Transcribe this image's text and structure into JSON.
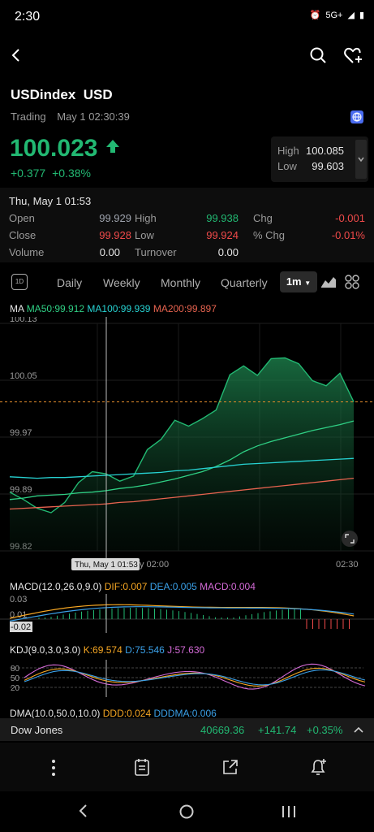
{
  "status": {
    "time": "2:30",
    "network": "5G+"
  },
  "header": {
    "title": "USDindex  USD",
    "trading_status": "Trading",
    "timestamp": "May 1 02:30:39",
    "price": "100.023",
    "change": "+0.377",
    "change_pct": "+0.38%",
    "high_label": "High",
    "high": "100.085",
    "low_label": "Low",
    "low": "99.603"
  },
  "details": {
    "date": "Thu, May 1 01:53",
    "open_label": "Open",
    "open": "99.929",
    "close_label": "Close",
    "close": "99.928",
    "volume_label": "Volume",
    "volume": "0.00",
    "high_label": "High",
    "high": "99.938",
    "low_label": "Low",
    "low": "99.924",
    "turnover_label": "Turnover",
    "turnover": "0.00",
    "chg_label": "Chg",
    "chg": "-0.001",
    "pct_chg_label": "% Chg",
    "pct_chg": "-0.01%"
  },
  "tabs": {
    "intraday_icon": "1D",
    "daily": "Daily",
    "weekly": "Weekly",
    "monthly": "Monthly",
    "quarterly": "Quarterly",
    "active": "1m"
  },
  "ma": {
    "label": "MA",
    "ma50": "MA50:99.912",
    "ma100": "MA100:99.939",
    "ma200": "MA200:99.897"
  },
  "colors": {
    "up": "#22b872",
    "down": "#f04a4a",
    "ma50": "#2fcf84",
    "ma100": "#27d3d3",
    "ma200": "#e7634f",
    "dif": "#f5a623",
    "dea": "#3aa0e8",
    "k": "#f5a623",
    "d": "#3aa0e8",
    "j": "#d36ad6"
  },
  "chart_data": {
    "type": "area",
    "y_ticks": [
      "100.13",
      "100.05",
      "99.97",
      "99.89",
      "99.82"
    ],
    "ylim": [
      99.82,
      100.13
    ],
    "x_ticks": [
      "y 02:00",
      "02:30"
    ],
    "crosshair_label": "Thu, May 1 01:53",
    "series": [
      {
        "name": "MA50",
        "values": [
          99.89,
          99.892,
          99.895,
          99.896,
          99.897,
          99.899,
          99.9,
          99.902,
          99.905,
          99.907,
          99.91,
          99.914,
          99.918,
          99.923,
          99.928,
          99.935,
          99.944,
          99.955,
          99.963,
          99.969,
          99.974,
          99.979,
          99.984,
          99.988,
          99.992,
          99.997
        ]
      },
      {
        "name": "MA100",
        "values": [
          99.921,
          99.92,
          99.919,
          99.92,
          99.92,
          99.921,
          99.922,
          99.923,
          99.924,
          99.925,
          99.926,
          99.927,
          99.929,
          99.93,
          99.932,
          99.934,
          99.936,
          99.938,
          99.939,
          99.94,
          99.941,
          99.942,
          99.943,
          99.944,
          99.945,
          99.946
        ]
      },
      {
        "name": "MA200",
        "values": [
          99.877,
          99.878,
          99.879,
          99.88,
          99.881,
          99.882,
          99.883,
          99.884,
          99.886,
          99.887,
          99.889,
          99.891,
          99.893,
          99.895,
          99.897,
          99.899,
          99.901,
          99.903,
          99.905,
          99.907,
          99.909,
          99.911,
          99.913,
          99.915,
          99.917,
          99.919
        ]
      },
      {
        "name": "Price",
        "values": [
          99.9,
          99.89,
          99.878,
          99.872,
          99.886,
          99.913,
          99.928,
          99.925,
          99.915,
          99.922,
          99.958,
          99.972,
          99.998,
          99.99,
          100.0,
          100.012,
          100.06,
          100.072,
          100.059,
          100.082,
          100.083,
          100.075,
          100.052,
          100.045,
          100.062,
          100.023
        ]
      }
    ],
    "reference_line": 100.023
  },
  "macd": {
    "label": "MACD(12.0,26.0,9.0)",
    "dif": "DIF:0.007",
    "dea": "DEA:0.005",
    "macd": "MACD:0.004",
    "ticks": [
      "0.03",
      "0.01",
      "-0.02"
    ]
  },
  "kdj": {
    "label": "KDJ(9.0,3.0,3.0)",
    "k": "K:69.574",
    "d": "D:75.546",
    "j": "J:57.630",
    "ticks": [
      "80",
      "50",
      "20"
    ]
  },
  "dma": {
    "label": "DMA(10.0,50.0,10.0)",
    "ddd": "DDD:0.024",
    "ddma": "DDDMA:0.006"
  },
  "ticker": {
    "name": "Dow Jones",
    "price": "40669.36",
    "change": "+141.74",
    "change_pct": "+0.35%"
  }
}
